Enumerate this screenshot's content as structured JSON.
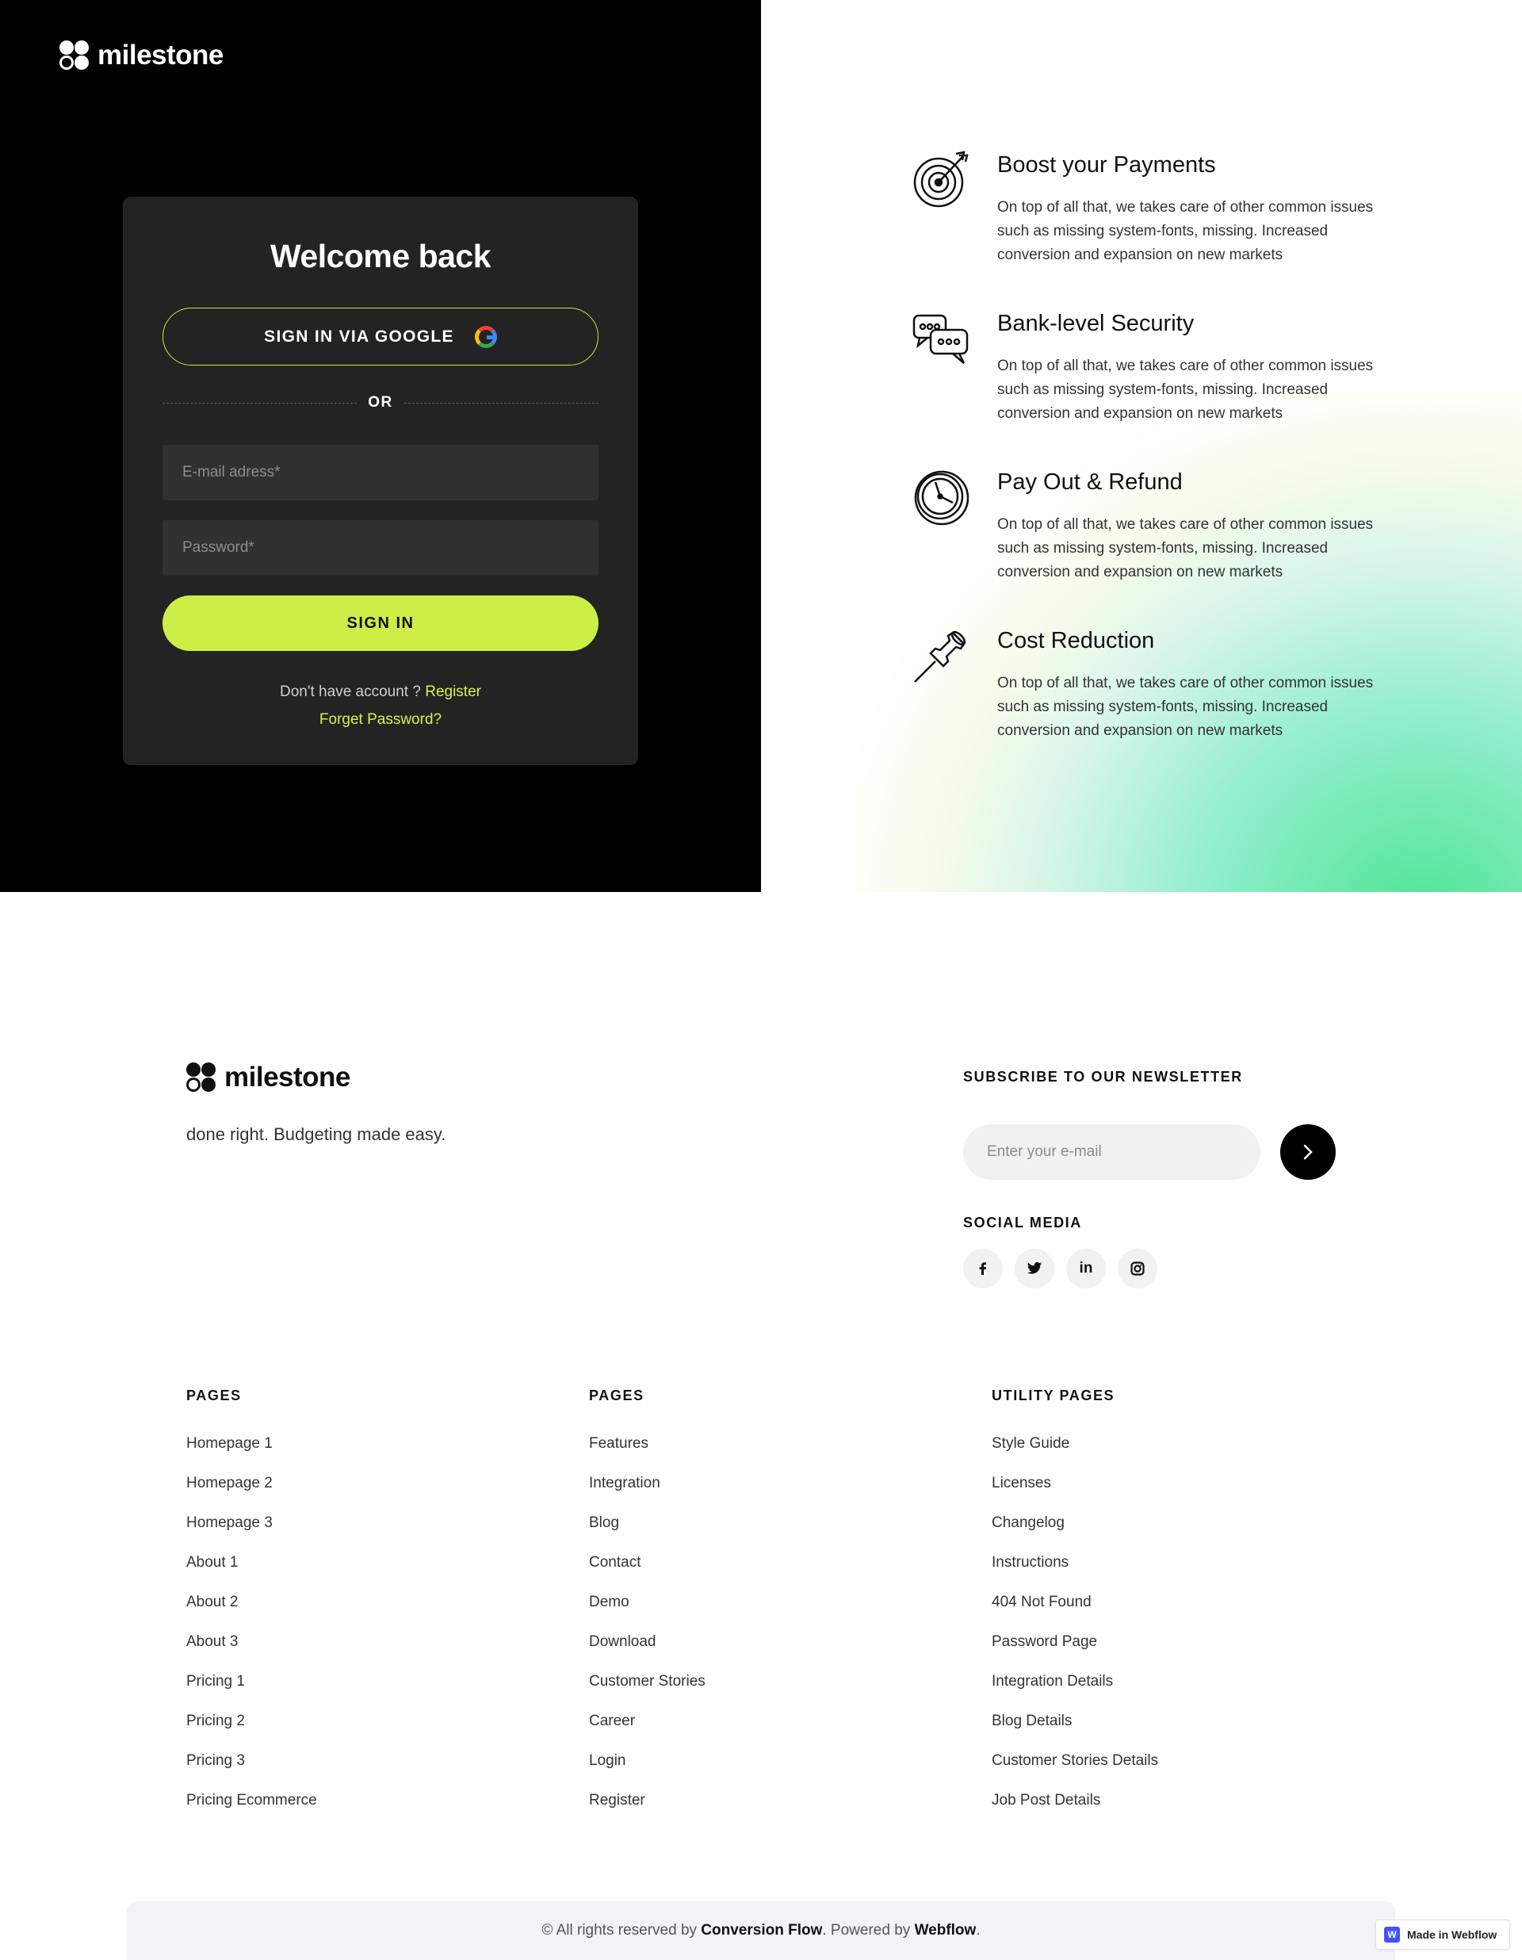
{
  "brand": {
    "name": "milestone"
  },
  "login": {
    "title": "Welcome back",
    "google_button": "SIGN IN VIA GOOGLE",
    "or_label": "OR",
    "email_placeholder": "E-mail adress*",
    "password_placeholder": "Password*",
    "signin_button": "SIGN IN",
    "no_account_text": "Don't have account ?",
    "register_link": "Register",
    "forget_link": "Forget Password?"
  },
  "features": [
    {
      "icon": "target-icon",
      "title": "Boost your Payments",
      "text": "On top of all that, we takes care of other common issues such as missing system-fonts, missing. Increased conversion and expansion on new markets"
    },
    {
      "icon": "chat-bubbles-icon",
      "title": "Bank-level Security",
      "text": "On top of all that, we takes care of other common issues such as missing system-fonts, missing. Increased conversion and expansion on new markets"
    },
    {
      "icon": "clock-icon",
      "title": "Pay Out & Refund",
      "text": "On top of all that, we takes care of other common issues such as missing system-fonts, missing. Increased conversion and expansion on new markets"
    },
    {
      "icon": "pushpin-icon",
      "title": "Cost Reduction",
      "text": "On top of all that, we takes care of other common issues such as missing system-fonts, missing. Increased conversion and expansion on new markets"
    }
  ],
  "footer": {
    "tagline": "done right. Budgeting made easy.",
    "newsletter_label": "SUBSCRIBE TO OUR NEWSLETTER",
    "newsletter_placeholder": "Enter your e-mail",
    "social_label": "SOCIAL MEDIA",
    "social": [
      {
        "icon": "facebook-icon",
        "glyph": "f"
      },
      {
        "icon": "twitter-icon",
        "glyph": "t"
      },
      {
        "icon": "linkedin-icon",
        "glyph": "in"
      },
      {
        "icon": "instagram-icon",
        "glyph": "ig"
      }
    ],
    "columns": [
      {
        "title": "PAGES",
        "links": [
          "Homepage 1",
          "Homepage 2",
          "Homepage 3",
          "About 1",
          "About 2",
          "About 3",
          "Pricing 1",
          "Pricing 2",
          "Pricing 3",
          "Pricing Ecommerce"
        ]
      },
      {
        "title": "PAGES",
        "links": [
          "Features",
          "Integration",
          "Blog",
          "Contact",
          "Demo",
          "Download",
          "Customer Stories",
          "Career",
          "Login",
          "Register"
        ]
      },
      {
        "title": "UTILITY PAGES",
        "links": [
          "Style Guide",
          "Licenses",
          "Changelog",
          "Instructions",
          "404 Not Found",
          "Password Page",
          "Integration Details",
          "Blog Details",
          "Customer Stories Details",
          "Job Post Details"
        ]
      }
    ],
    "copyright": {
      "prefix": "© All rights reserved by",
      "company": "Conversion Flow",
      "middle": ". Powered by",
      "platform": "Webflow",
      "suffix": "."
    },
    "badge": "Made in Webflow"
  },
  "colors": {
    "accent": "#cdee47",
    "dark": "#000000",
    "card": "#232323"
  }
}
